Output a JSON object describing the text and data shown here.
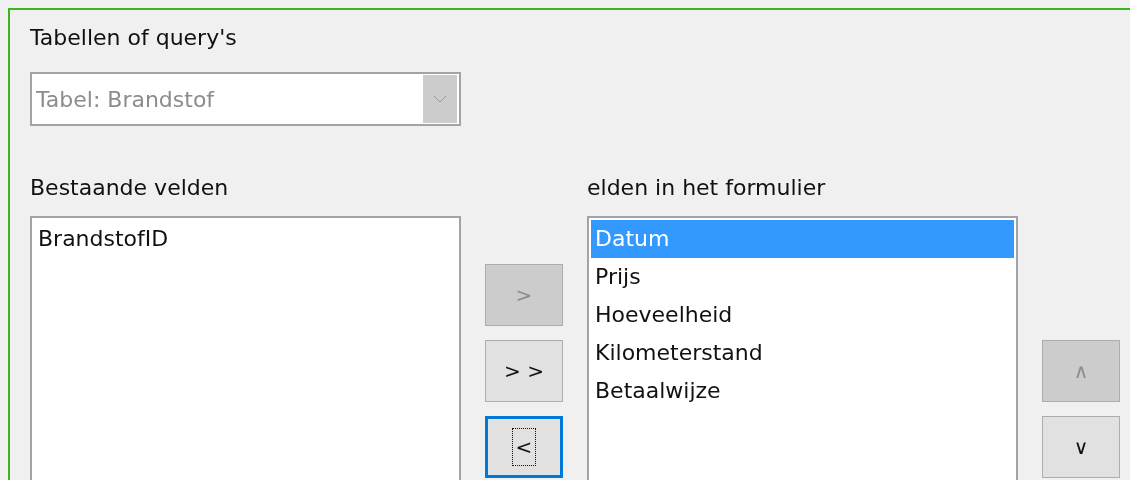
{
  "source": {
    "label": "Tabellen of query's",
    "value": "Tabel: Brandstof",
    "disabled": true
  },
  "available": {
    "label": "Bestaande velden",
    "items": [
      {
        "text": "BrandstofID",
        "selected": false
      }
    ]
  },
  "form_fields": {
    "label": "elden in het formulier",
    "items": [
      {
        "text": "Datum",
        "selected": true
      },
      {
        "text": "Prijs",
        "selected": false
      },
      {
        "text": "Hoeveelheid",
        "selected": false
      },
      {
        "text": "Kilometerstand",
        "selected": false
      },
      {
        "text": "Betaalwijze",
        "selected": false
      }
    ]
  },
  "transfer_buttons": [
    {
      "label": ">",
      "disabled": true,
      "focused": false
    },
    {
      "label": "> >",
      "disabled": false,
      "focused": false
    },
    {
      "label": "<",
      "disabled": false,
      "focused": true
    }
  ],
  "order_buttons": [
    {
      "label": "∧",
      "disabled": true,
      "focused": false
    },
    {
      "label": "∨",
      "disabled": false,
      "focused": false
    }
  ]
}
